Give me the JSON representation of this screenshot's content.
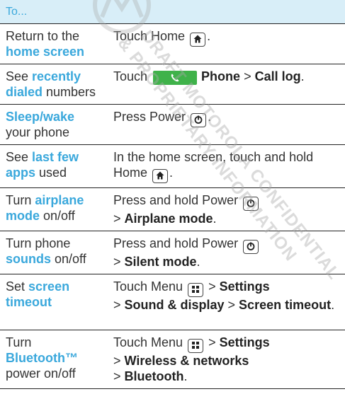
{
  "header": {
    "label": "To..."
  },
  "rows": [
    {
      "action": [
        "Return to the ",
        "home screen"
      ],
      "how": "Touch Home"
    },
    {
      "action": [
        "See ",
        "recently dialed",
        " numbers"
      ],
      "how": [
        "Touch",
        "Phone",
        " > ",
        "Call log",
        "."
      ]
    },
    {
      "action": [
        "Sleep/wake",
        " your phone"
      ],
      "how": "Press Power"
    },
    {
      "action": [
        "See ",
        "last few apps",
        " used"
      ],
      "how": "In the home screen, touch and hold Home"
    },
    {
      "action": [
        "Turn ",
        "airplane mode",
        " on/off"
      ],
      "how": [
        "Press and hold Power",
        "> ",
        "Airplane mode",
        "."
      ]
    },
    {
      "action": [
        "Turn phone ",
        "sounds",
        " on/off"
      ],
      "how": [
        "Press and hold Power",
        "> ",
        "Silent mode",
        "."
      ]
    },
    {
      "action": [
        "Set ",
        "screen timeout"
      ],
      "how": [
        "Touch Menu",
        " > ",
        "Settings",
        "> ",
        "Sound & display",
        " > ",
        "Screen timeout",
        "."
      ]
    },
    {
      "action": [
        "Turn ",
        "Bluetooth™",
        " power on/off"
      ],
      "how": [
        "Touch Menu",
        " > ",
        "Settings",
        "> ",
        "Wireless & networks",
        "> ",
        "Bluetooth",
        "."
      ]
    }
  ],
  "watermark": {
    "line1": "DRAFT MOTOROLA CONFIDENTIAL",
    "line2": "& PROPRIETARY INFORMATION"
  },
  "colors": {
    "accent": "#3aa8dc",
    "header_bg": "#d8eef8",
    "phone_green": "#3fb24a"
  },
  "icons": {
    "home": "home-key-icon",
    "power": "power-key-icon",
    "menu": "menu-key-icon",
    "phone": "phone-handset-icon"
  }
}
